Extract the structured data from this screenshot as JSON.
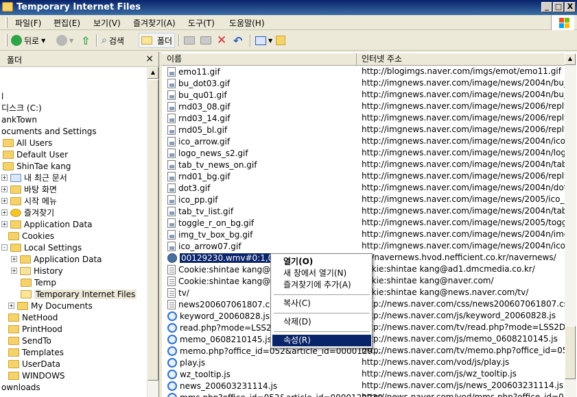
{
  "window": {
    "title": "Temporary Internet Files"
  },
  "window_buttons": [
    "_",
    "□",
    "X"
  ],
  "menu": [
    "파일(F)",
    "편집(E)",
    "보기(V)",
    "즐겨찾기(A)",
    "도구(T)",
    "도움말(H)"
  ],
  "toolbar": {
    "back": "뒤로",
    "search": "검색",
    "folders": "폴더"
  },
  "folders_pane": {
    "title": "폴더",
    "close": "×"
  },
  "tree": [
    {
      "label": "l",
      "expander": ""
    },
    {
      "label": "디스크 (C:)",
      "expander": ""
    },
    {
      "label": "ankTown",
      "expander": ""
    },
    {
      "label": "ocuments and Settings",
      "expander": ""
    },
    {
      "label": "All Users",
      "expander": ""
    },
    {
      "label": "Default User",
      "expander": ""
    },
    {
      "label": "ShinTae kang",
      "expander": ""
    },
    {
      "label": "내 최근 문서",
      "expander": "+"
    },
    {
      "label": "바탕 화면",
      "expander": "+"
    },
    {
      "label": "시작 메뉴",
      "expander": "+"
    },
    {
      "label": "즐겨찾기",
      "expander": "+"
    },
    {
      "label": "Application Data",
      "expander": "+"
    },
    {
      "label": "Cookies",
      "expander": ""
    },
    {
      "label": "Local Settings",
      "expander": "-"
    },
    {
      "label": "Application Data",
      "expander": "+"
    },
    {
      "label": "History",
      "expander": "+"
    },
    {
      "label": "Temp",
      "expander": ""
    },
    {
      "label": "Temporary Internet Files",
      "expander": ""
    },
    {
      "label": "My Documents",
      "expander": "+"
    },
    {
      "label": "NetHood",
      "expander": ""
    },
    {
      "label": "PrintHood",
      "expander": ""
    },
    {
      "label": "SendTo",
      "expander": ""
    },
    {
      "label": "Templates",
      "expander": ""
    },
    {
      "label": "UserData",
      "expander": ""
    },
    {
      "label": "WINDOWS",
      "expander": ""
    },
    {
      "label": "ownloads",
      "expander": ""
    }
  ],
  "columns": {
    "name": "이름",
    "address": "인터넷 주소"
  },
  "files": [
    {
      "name": "emo11.gif",
      "address": "http://blogimgs.naver.com/imgs/emot/emo11.gif",
      "icon": "gif"
    },
    {
      "name": "bu_dot03.gif",
      "address": "http://imgnews.naver.com/image/news/2004n/bu_d",
      "icon": "gif"
    },
    {
      "name": "bu_qu01.gif",
      "address": "http://imgnews.naver.com/image/news/2004n/bu_q",
      "icon": "gif"
    },
    {
      "name": "rnd03_08.gif",
      "address": "http://imgnews.naver.com/image/news/2006/reply/",
      "icon": "gif"
    },
    {
      "name": "rnd03_14.gif",
      "address": "http://imgnews.naver.com/image/news/2006/reply/",
      "icon": "gif"
    },
    {
      "name": "rnd05_bl.gif",
      "address": "http://imgnews.naver.com/image/news/2006/reply/",
      "icon": "gif"
    },
    {
      "name": "ico_arrow.gif",
      "address": "http://imgnews.naver.com/image/news/2004n/ico_",
      "icon": "gif"
    },
    {
      "name": "logo_news_s2.gif",
      "address": "http://imgnews.naver.com/image/news/2004n/logo",
      "icon": "gif"
    },
    {
      "name": "tab_tv_news_on.gif",
      "address": "http://imgnews.naver.com/image/news/2004n/tab_",
      "icon": "gif"
    },
    {
      "name": "rnd01_bg.gif",
      "address": "http://imgnews.naver.com/image/news/2006/reply/",
      "icon": "gif"
    },
    {
      "name": "dot3.gif",
      "address": "http://imgnews.naver.com/image/news/2004n/dot3",
      "icon": "gif"
    },
    {
      "name": "ico_pp.gif",
      "address": "http://imgnews.naver.com/image/news/2005/ico_p",
      "icon": "gif"
    },
    {
      "name": "tab_tv_list.gif",
      "address": "http://imgnews.naver.com/image/news/2004n/tab_",
      "icon": "gif"
    },
    {
      "name": "toggle_r_on_bg.gif",
      "address": "http://imgnews.naver.com/image/news/2005/toggle",
      "icon": "gif"
    },
    {
      "name": "img_tv_box_bg.gif",
      "address": "http://imgnews.naver.com/image/news/2004n/img_",
      "icon": "gif"
    },
    {
      "name": "ico_arrow07.gif",
      "address": "http://imgnews.naver.com/image/news/2004n/ico_",
      "icon": "gif"
    },
    {
      "name": "00129230.wmv#0:1,000:0",
      "address": "s://navernews.hvod.nefficient.co.kr/navernews/",
      "icon": "media"
    },
    {
      "name": "Cookie:shintae kang@a",
      "address": "ookie:shintae kang@ad1.dmcmedia.co.kr/",
      "icon": "txt"
    },
    {
      "name": "Cookie:shintae kang@n",
      "address": "ookie:shintae kang@naver.com/",
      "icon": "txt"
    },
    {
      "name": "tv/",
      "address": "ookie:shintae kang@news.naver.com/tv/",
      "icon": "txt"
    },
    {
      "name": "news200607061807.css",
      "address": "http://news.naver.com/css/news200607061807.css",
      "icon": "txt"
    },
    {
      "name": "keyword_20060828.js",
      "address": "http://news.naver.com/js/keyword_20060828.js",
      "icon": "ie"
    },
    {
      "name": "read.php?mode=LSS2D",
      "address": "http://news.naver.com/tv/read.php?mode=LSS2D&s",
      "icon": "ie"
    },
    {
      "name": "memo_0608210145.js",
      "address": "http://news.naver.com/js/memo_0608210145.js",
      "icon": "ie"
    },
    {
      "name": "memo.php?office_id=052&article_id=0000129...",
      "address": "http://news.naver.com/tv/memo.php?office_id=052&",
      "icon": "ie"
    },
    {
      "name": "play.js",
      "address": "http://news.naver.com/vod/js/play.js",
      "icon": "ie"
    },
    {
      "name": "wz_tooltip.js",
      "address": "http://news.naver.com/js/wz_tooltip.js",
      "icon": "ie"
    },
    {
      "name": "news_200603231114.js",
      "address": "http://news.naver.com/js/news_200603231114.js",
      "icon": "ie"
    },
    {
      "name": "mms.php?office_id=052&article_id=0000129230",
      "address": "http://news.naver.com/vod/mms.php?office_id=0528",
      "icon": "ie"
    }
  ],
  "context_menu": {
    "open": "열기(O)",
    "open_new": "새 창에서 열기(N)",
    "add_fav": "즐겨찾기에 추가(A)",
    "copy": "복사(C)",
    "delete": "삭제(D)",
    "properties": "속성(R)"
  },
  "colors": {
    "selection": "#0a246a",
    "title_start": "#0a246a",
    "title_end": "#3a6ea5",
    "face": "#ece9d8"
  }
}
